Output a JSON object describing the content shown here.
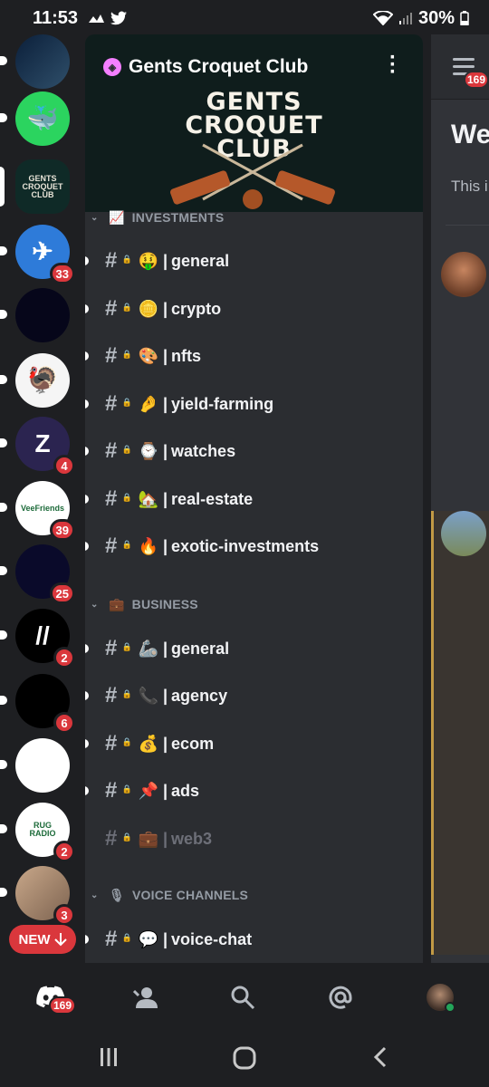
{
  "status_bar": {
    "time": "11:53",
    "battery": "30%"
  },
  "rail": {
    "servers": [
      {
        "name": "server-1",
        "badge": "",
        "colors": [
          "#0b1f3a",
          "#2f4f6a"
        ],
        "glyph": ""
      },
      {
        "name": "server-whale",
        "badge": "",
        "colors": [
          "#2bd45f",
          "#2bd45f"
        ],
        "glyph": "🐳"
      },
      {
        "name": "gents-croquet-club",
        "badge": "",
        "colors": [
          "#0f2a27",
          "#0f2a27"
        ],
        "glyph": "GENTS CROQUET CLUB",
        "selected": true
      },
      {
        "name": "server-telegram",
        "badge": "33",
        "colors": [
          "#2e7bd9",
          "#2e7bd9"
        ],
        "glyph": "✈"
      },
      {
        "name": "server-adidas",
        "badge": "",
        "colors": [
          "#06061a",
          "#06061a"
        ],
        "glyph": ""
      },
      {
        "name": "server-turkey",
        "badge": "",
        "colors": [
          "#f5f5f5",
          "#f5f5f5"
        ],
        "glyph": "🦃"
      },
      {
        "name": "server-z",
        "badge": "4",
        "colors": [
          "#2b2450",
          "#2b2450"
        ],
        "glyph": "Z"
      },
      {
        "name": "server-veefriends",
        "badge": "39",
        "colors": [
          "#ffffff",
          "#ffffff"
        ],
        "glyph": "VeeFriends"
      },
      {
        "name": "server-neon",
        "badge": "25",
        "colors": [
          "#0a0a2a",
          "#0a0a2a"
        ],
        "glyph": ""
      },
      {
        "name": "server-slash",
        "badge": "2",
        "colors": [
          "#000000",
          "#000000"
        ],
        "glyph": "//"
      },
      {
        "name": "server-diamond",
        "badge": "6",
        "colors": [
          "#000000",
          "#000000"
        ],
        "glyph": ""
      },
      {
        "name": "server-devil",
        "badge": "",
        "colors": [
          "#ffffff",
          "#ffffff"
        ],
        "glyph": ""
      },
      {
        "name": "server-rug-radio",
        "badge": "2",
        "colors": [
          "#ffffff",
          "#ffffff"
        ],
        "glyph": "RUG RADIO"
      },
      {
        "name": "server-avatar",
        "badge": "3",
        "colors": [
          "#c9a88a",
          "#7d6350"
        ],
        "glyph": ""
      }
    ],
    "new_label": "NEW"
  },
  "server": {
    "name": "Gents Croquet Club",
    "logo_lines": [
      "GENTS",
      "CROQUET",
      "CLUB"
    ]
  },
  "categories": [
    {
      "label": "INVESTMENTS",
      "emoji": "📈"
    },
    {
      "label": "BUSINESS",
      "emoji": "💼"
    },
    {
      "label": "VOICE CHANNELS",
      "emoji": "🎙"
    }
  ],
  "channels": [
    {
      "emoji": "🤑",
      "name": "general",
      "unread": true,
      "muted": false
    },
    {
      "emoji": "🪙",
      "name": "crypto",
      "unread": true,
      "muted": false
    },
    {
      "emoji": "🎨",
      "name": "nfts",
      "unread": true,
      "muted": false
    },
    {
      "emoji": "🤌",
      "name": "yield-farming",
      "unread": true,
      "muted": false
    },
    {
      "emoji": "⌚",
      "name": "watches",
      "unread": true,
      "muted": false
    },
    {
      "emoji": "🏡",
      "name": "real-estate",
      "unread": true,
      "muted": false
    },
    {
      "emoji": "🔥",
      "name": "exotic-investments",
      "unread": true,
      "muted": false
    },
    {
      "emoji": "🦾",
      "name": "general",
      "unread": true,
      "muted": false
    },
    {
      "emoji": "📞",
      "name": "agency",
      "unread": true,
      "muted": false
    },
    {
      "emoji": "💰",
      "name": "ecom",
      "unread": true,
      "muted": false
    },
    {
      "emoji": "📌",
      "name": "ads",
      "unread": true,
      "muted": false
    },
    {
      "emoji": "💼",
      "name": "web3",
      "unread": false,
      "muted": true
    },
    {
      "emoji": "💬",
      "name": "voice-chat",
      "unread": true,
      "muted": false
    }
  ],
  "peek": {
    "welcome": "We",
    "subtitle": "This i",
    "notif_badge": "169"
  },
  "tabs": {
    "home_badge": "169"
  },
  "colors": {
    "accent": "#da373c",
    "online": "#23a55a",
    "bg": "#1e1f22",
    "panel": "#2b2d31"
  }
}
